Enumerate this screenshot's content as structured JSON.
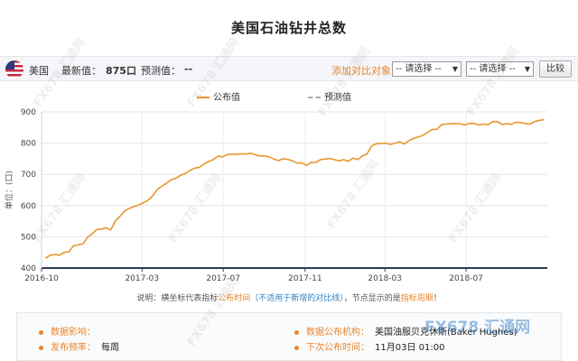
{
  "page": {
    "title": "美国石油钻井总数",
    "country": "美国",
    "latest_label": "最新值：",
    "latest_value": "875口",
    "forecast_label": "预测值：",
    "forecast_value": "--",
    "compare_label": "添加对比对象：",
    "select1": "-- 请选择 --",
    "select2": "-- 请选择 --",
    "compare_button": "比较"
  },
  "legend": {
    "published": "公布值",
    "forecast": "预测值"
  },
  "note": {
    "prefix": "说明：横坐标代表指标",
    "hl1": "公布时间",
    "mid": "（不适用于新增的对比线）",
    "mid2": "，节点显示的是",
    "hl2": "指标周期",
    "suffix": "！"
  },
  "info": {
    "impact_label": "数据影响：",
    "impact_value": "",
    "freq_label": "发布频率：",
    "freq_value": "每周",
    "org_label": "数据公布机构：",
    "org_value": "美国油服贝克休斯(Baker Hughes)",
    "next_label": "下次公布时间：",
    "next_value": "11月03日 01:00"
  },
  "watermark": {
    "text": "FX678 汇通网",
    "brand": "FX678 汇通网"
  },
  "colors": {
    "line": "#e8962f",
    "accent": "#e8852b",
    "axis": "#2d3b55"
  },
  "chart_data": {
    "type": "line",
    "ylabel": "单位：(口)",
    "ylim": [
      400,
      900
    ],
    "yticks": [
      400,
      500,
      600,
      700,
      800,
      900
    ],
    "xlim": [
      "2016-10-01",
      "2018-10-31"
    ],
    "xticks": [
      "2016-10",
      "2017-03",
      "2017-07",
      "2017-11",
      "2018-03",
      "2018-07"
    ],
    "grid": true,
    "legend_position": "top-center",
    "series": [
      {
        "name": "公布值",
        "style": "solid",
        "points": [
          [
            "2016-10-07",
            432
          ],
          [
            "2016-10-14",
            441
          ],
          [
            "2016-10-21",
            443
          ],
          [
            "2016-10-28",
            441
          ],
          [
            "2016-11-04",
            450
          ],
          [
            "2016-11-11",
            452
          ],
          [
            "2016-11-18",
            471
          ],
          [
            "2016-11-25",
            474
          ],
          [
            "2016-12-02",
            477
          ],
          [
            "2016-12-09",
            498
          ],
          [
            "2016-12-16",
            510
          ],
          [
            "2016-12-23",
            523
          ],
          [
            "2016-12-30",
            525
          ],
          [
            "2017-01-06",
            529
          ],
          [
            "2017-01-13",
            522
          ],
          [
            "2017-01-20",
            551
          ],
          [
            "2017-01-27",
            566
          ],
          [
            "2017-02-03",
            583
          ],
          [
            "2017-02-10",
            591
          ],
          [
            "2017-02-17",
            597
          ],
          [
            "2017-02-24",
            602
          ],
          [
            "2017-03-03",
            609
          ],
          [
            "2017-03-10",
            617
          ],
          [
            "2017-03-17",
            631
          ],
          [
            "2017-03-24",
            652
          ],
          [
            "2017-03-31",
            662
          ],
          [
            "2017-04-07",
            672
          ],
          [
            "2017-04-14",
            683
          ],
          [
            "2017-04-21",
            688
          ],
          [
            "2017-04-28",
            697
          ],
          [
            "2017-05-05",
            703
          ],
          [
            "2017-05-12",
            712
          ],
          [
            "2017-05-19",
            720
          ],
          [
            "2017-05-26",
            722
          ],
          [
            "2017-06-02",
            733
          ],
          [
            "2017-06-09",
            741
          ],
          [
            "2017-06-16",
            747
          ],
          [
            "2017-06-23",
            758
          ],
          [
            "2017-06-30",
            756
          ],
          [
            "2017-07-07",
            763
          ],
          [
            "2017-07-14",
            765
          ],
          [
            "2017-07-21",
            764
          ],
          [
            "2017-07-28",
            766
          ],
          [
            "2017-08-04",
            765
          ],
          [
            "2017-08-11",
            768
          ],
          [
            "2017-08-18",
            763
          ],
          [
            "2017-08-25",
            759
          ],
          [
            "2017-09-01",
            759
          ],
          [
            "2017-09-08",
            756
          ],
          [
            "2017-09-15",
            749
          ],
          [
            "2017-09-22",
            744
          ],
          [
            "2017-09-29",
            750
          ],
          [
            "2017-10-06",
            748
          ],
          [
            "2017-10-13",
            743
          ],
          [
            "2017-10-20",
            736
          ],
          [
            "2017-10-27",
            737
          ],
          [
            "2017-11-03",
            729
          ],
          [
            "2017-11-10",
            738
          ],
          [
            "2017-11-17",
            738
          ],
          [
            "2017-11-24",
            747
          ],
          [
            "2017-12-01",
            749
          ],
          [
            "2017-12-08",
            751
          ],
          [
            "2017-12-15",
            747
          ],
          [
            "2017-12-22",
            743
          ],
          [
            "2017-12-29",
            747
          ],
          [
            "2018-01-05",
            742
          ],
          [
            "2018-01-12",
            752
          ],
          [
            "2018-01-19",
            747
          ],
          [
            "2018-01-26",
            759
          ],
          [
            "2018-02-02",
            765
          ],
          [
            "2018-02-09",
            791
          ],
          [
            "2018-02-16",
            798
          ],
          [
            "2018-02-23",
            799
          ],
          [
            "2018-03-02",
            800
          ],
          [
            "2018-03-09",
            796
          ],
          [
            "2018-03-16",
            800
          ],
          [
            "2018-03-23",
            804
          ],
          [
            "2018-03-30",
            797
          ],
          [
            "2018-04-06",
            808
          ],
          [
            "2018-04-13",
            815
          ],
          [
            "2018-04-20",
            820
          ],
          [
            "2018-04-27",
            825
          ],
          [
            "2018-05-04",
            834
          ],
          [
            "2018-05-11",
            844
          ],
          [
            "2018-05-18",
            844
          ],
          [
            "2018-05-25",
            859
          ],
          [
            "2018-06-01",
            861
          ],
          [
            "2018-06-08",
            862
          ],
          [
            "2018-06-15",
            863
          ],
          [
            "2018-06-22",
            862
          ],
          [
            "2018-06-29",
            858
          ],
          [
            "2018-07-06",
            863
          ],
          [
            "2018-07-13",
            863
          ],
          [
            "2018-07-20",
            858
          ],
          [
            "2018-07-27",
            861
          ],
          [
            "2018-08-03",
            859
          ],
          [
            "2018-08-10",
            869
          ],
          [
            "2018-08-17",
            869
          ],
          [
            "2018-08-24",
            860
          ],
          [
            "2018-08-31",
            862
          ],
          [
            "2018-09-07",
            860
          ],
          [
            "2018-09-14",
            867
          ],
          [
            "2018-09-21",
            866
          ],
          [
            "2018-09-28",
            863
          ],
          [
            "2018-10-05",
            861
          ],
          [
            "2018-10-12",
            869
          ],
          [
            "2018-10-19",
            873
          ],
          [
            "2018-10-26",
            875
          ]
        ]
      },
      {
        "name": "预测值",
        "style": "dashed",
        "points": []
      }
    ]
  }
}
